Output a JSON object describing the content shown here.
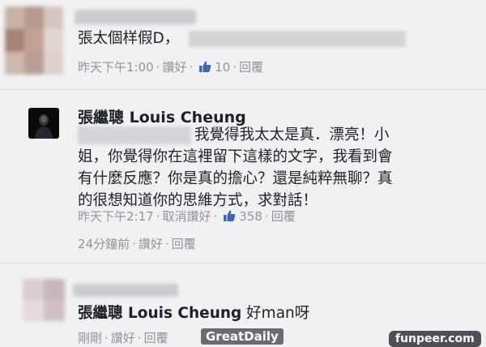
{
  "comment1": {
    "text": "張太個样假D，",
    "time": "昨天下午1:00",
    "like_label": "讚好",
    "like_count": "10",
    "reply_label": "回覆"
  },
  "reply": {
    "author": "張繼聰 Louis Cheung",
    "line1": "我覺得我太太是真．漂亮！小",
    "line2": "姐，你覺得你在這裡留下這樣的文字，我看到會",
    "line3": "有什麼反應？你是真的擔心？還是純粹無聊？真",
    "line4": "的很想知道你的思維方式，求對話！",
    "time": "昨天下午2:17",
    "unlike_label": "取消讚好",
    "like_count": "358",
    "reply_label": "回覆"
  },
  "comment1_footer": {
    "time": "24分鐘前",
    "like_label": "讚好",
    "reply_label": "回覆"
  },
  "comment2": {
    "mention": "張繼聰 Louis Cheung",
    "text": "好man呀",
    "time": "剛剛",
    "like_label": "讚好",
    "reply_label": "回覆"
  },
  "watermarks": {
    "left": "GreatDaily",
    "right": "funpeer.com"
  },
  "colors": {
    "link": "#90949c",
    "like_blue": "#4267b2",
    "background": "#f0f1f3"
  }
}
